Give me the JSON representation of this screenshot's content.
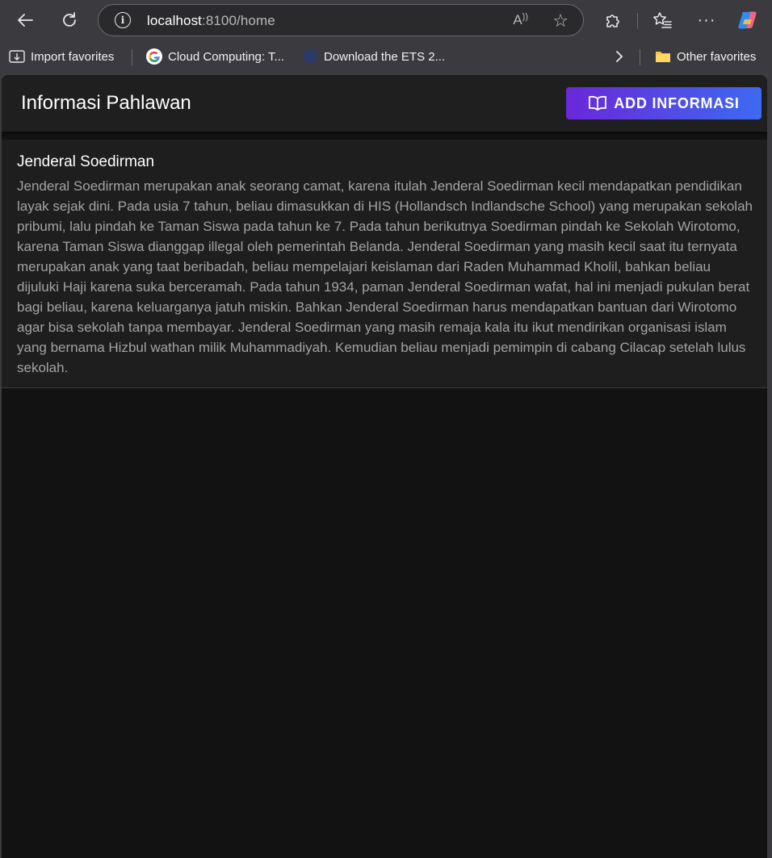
{
  "browser": {
    "url_host": "localhost",
    "url_rest": ":8100/home",
    "read_aloud_glyph": "Ȃ",
    "bookmarks": [
      {
        "label": "Import favorites",
        "icon": "import-icon"
      },
      {
        "label": "Cloud Computing: T...",
        "icon": "google-icon"
      },
      {
        "label": "Download the ETS 2...",
        "icon": "globe-icon"
      }
    ],
    "other_favorites": "Other favorites"
  },
  "header": {
    "title": "Informasi Pahlawan",
    "add_button": "ADD INFORMASI",
    "accent_start": "#6a28d8",
    "accent_end": "#3d6af0"
  },
  "items": [
    {
      "name": "Jenderal Soedirman",
      "description": "Jenderal Soedirman merupakan anak seorang camat, karena itulah Jenderal Soedirman kecil mendapatkan pendidikan layak sejak dini. Pada usia 7 tahun, beliau dimasukkan di HIS (Hollandsch Indlandsche School) yang merupakan sekolah pribumi, lalu pindah ke Taman Siswa pada tahun ke 7. Pada tahun berikutnya Soedirman pindah ke Sekolah Wirotomo, karena Taman Siswa dianggap illegal oleh pemerintah Belanda. Jenderal Soedirman yang masih kecil saat itu ternyata merupakan anak yang taat beribadah, beliau mempelajari keislaman dari Raden Muhammad Kholil, bahkan beliau dijuluki Haji karena suka berceramah. Pada tahun 1934, paman Jenderal Soedirman wafat, hal ini menjadi pukulan berat bagi beliau, karena keluarganya jatuh miskin. Bahkan Jenderal Soedirman harus mendapatkan bantuan dari Wirotomo agar bisa sekolah tanpa membayar. Jenderal Soedirman yang masih remaja kala itu ikut mendirikan organisasi islam yang bernama Hizbul wathan milik Muhammadiyah. Kemudian beliau menjadi pemimpin di cabang Cilacap setelah lulus sekolah."
    }
  ]
}
